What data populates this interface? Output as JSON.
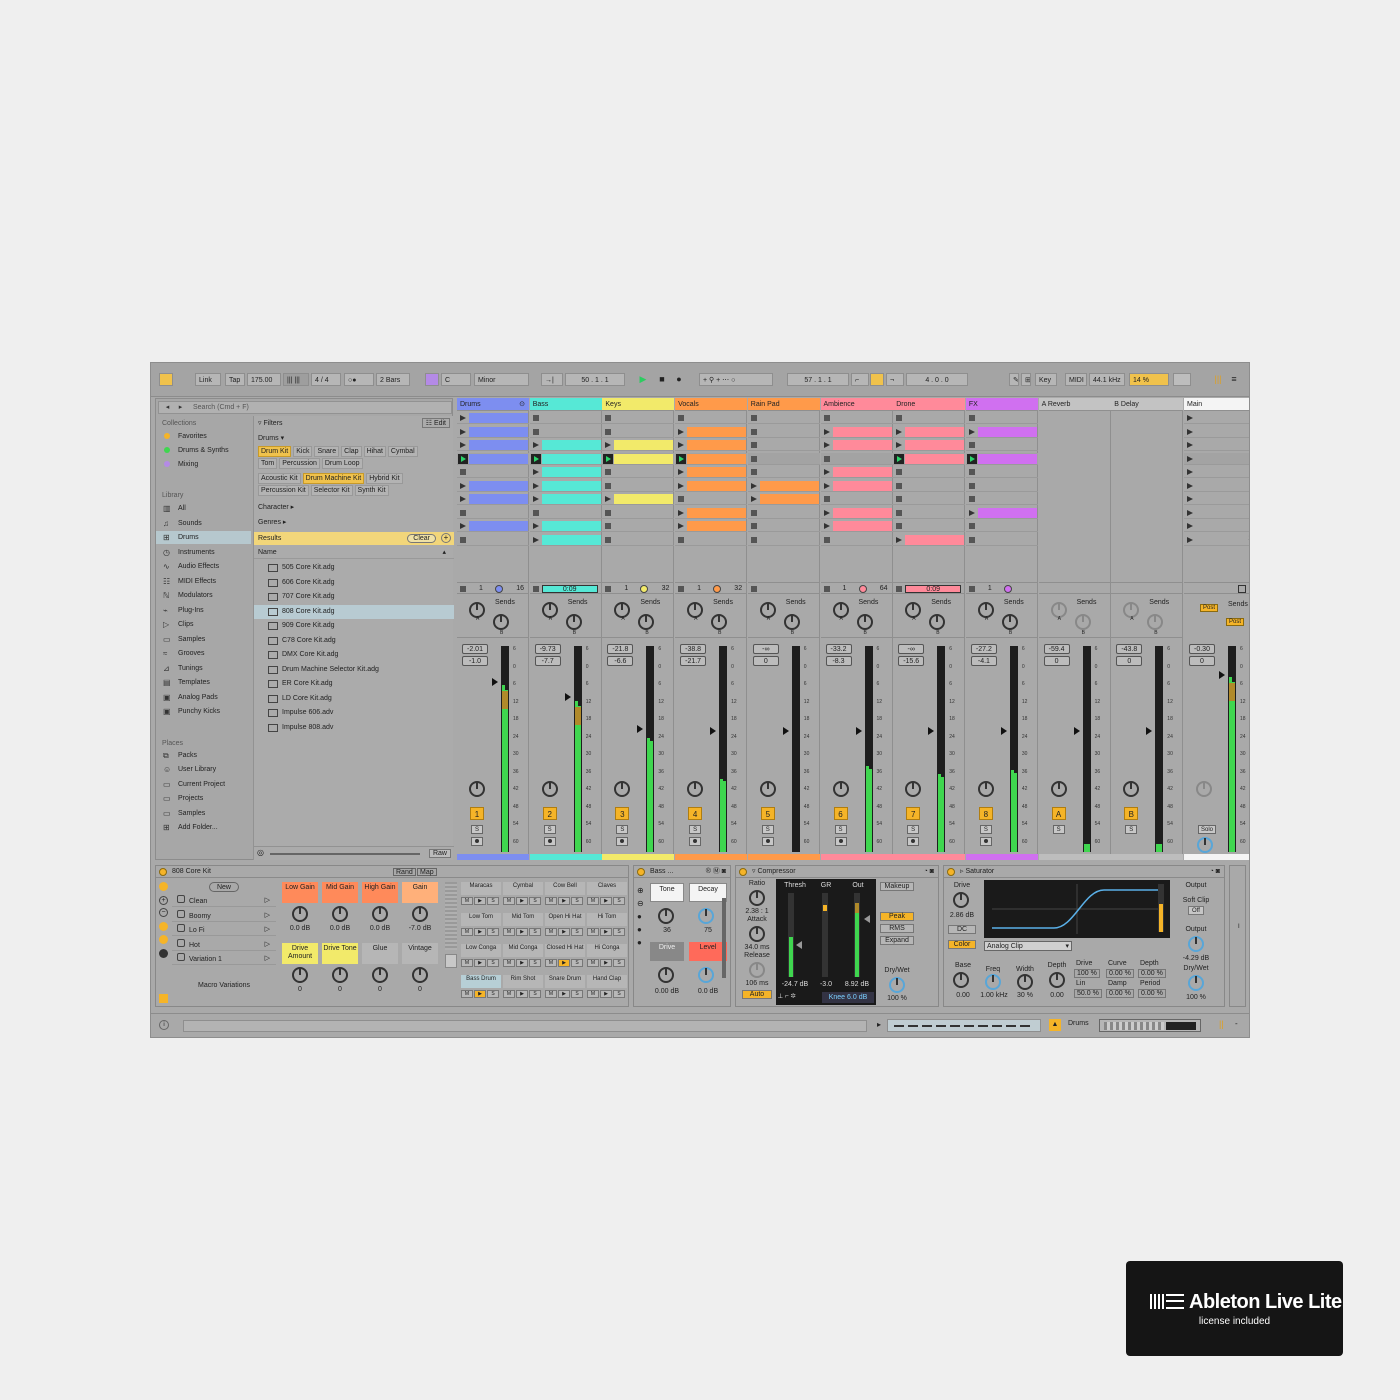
{
  "transport": {
    "link": "Link",
    "tap": "Tap",
    "tempo": "175.00",
    "signature": "4 / 4",
    "quantize": "2 Bars",
    "key": "C",
    "scale": "Minor",
    "arrangement_position": "50 .   1 .   1",
    "loop_start": "57 .   1 .   1",
    "loop_length": "4 .   0 .   0",
    "key_map": "Key",
    "midi_map": "MIDI",
    "sample_rate": "44.1 kHz",
    "cpu": "14 %"
  },
  "browser": {
    "search_placeholder": "Search (Cmd + F)",
    "collections_title": "Collections",
    "collections": [
      {
        "label": "Favorites",
        "color": "#f5b428"
      },
      {
        "label": "Drums & Synths",
        "color": "#3fd64f"
      },
      {
        "label": "Mixing",
        "color": "#b48ae6"
      }
    ],
    "library_title": "Library",
    "library": [
      {
        "label": "All",
        "icon": "bars-icon"
      },
      {
        "label": "Sounds",
        "icon": "note-icon"
      },
      {
        "label": "Drums",
        "icon": "grid-icon"
      },
      {
        "label": "Instruments",
        "icon": "clock-icon"
      },
      {
        "label": "Audio Effects",
        "icon": "wave-icon"
      },
      {
        "label": "MIDI Effects",
        "icon": "midi-icon"
      },
      {
        "label": "Modulators",
        "icon": "mod-icon"
      },
      {
        "label": "Plug-Ins",
        "icon": "plug-icon"
      },
      {
        "label": "Clips",
        "icon": "clip-icon"
      },
      {
        "label": "Samples",
        "icon": "sample-icon"
      },
      {
        "label": "Grooves",
        "icon": "groove-icon"
      },
      {
        "label": "Tunings",
        "icon": "tuning-icon"
      },
      {
        "label": "Templates",
        "icon": "template-icon"
      },
      {
        "label": "Analog Pads",
        "icon": "folder-icon"
      },
      {
        "label": "Punchy Kicks",
        "icon": "folder-icon"
      }
    ],
    "places_title": "Places",
    "places": [
      {
        "label": "Packs"
      },
      {
        "label": "User Library"
      },
      {
        "label": "Current Project"
      },
      {
        "label": "Projects"
      },
      {
        "label": "Samples"
      },
      {
        "label": "Add Folder..."
      }
    ],
    "filters_label": "Filters",
    "edit_label": "Edit",
    "drums_label": "Drums",
    "tags_row1": [
      "Drum Kit",
      "Kick",
      "Snare",
      "Clap",
      "Hihat",
      "Cymbal"
    ],
    "tags_row2": [
      "Tom",
      "Percussion",
      "Drum Loop"
    ],
    "tags_row3": [
      "Acoustic Kit",
      "Drum Machine Kit",
      "Hybrid Kit"
    ],
    "tags_row4": [
      "Percussion Kit",
      "Selector Kit",
      "Synth Kit"
    ],
    "character_label": "Character",
    "genres_label": "Genres",
    "results_label": "Results",
    "clear_label": "Clear",
    "name_header": "Name",
    "results": [
      "505 Core Kit.adg",
      "606 Core Kit.adg",
      "707 Core Kit.adg",
      "808 Core Kit.adg",
      "909 Core Kit.adg",
      "C78 Core Kit.adg",
      "DMX Core Kit.adg",
      "Drum Machine Selector Kit.adg",
      "ER Core Kit.adg",
      "LD Core Kit.adg",
      "Impulse 606.adv",
      "Impulse 808.adv"
    ],
    "raw_label": "Raw"
  },
  "tracks": [
    {
      "name": "Drums",
      "color": "#7d8ef0",
      "stop_a": "1",
      "stop_b": "16",
      "vol": "-2.01",
      "vol2": "-1.0",
      "num": "1",
      "meter": 0.82
    },
    {
      "name": "Bass",
      "color": "#56e8d6",
      "progress": "0:09",
      "vol": "-9.73",
      "vol2": "-7.7",
      "num": "2",
      "meter": 0.74
    },
    {
      "name": "Keys",
      "color": "#f2ea6a",
      "stop_a": "1",
      "stop_b": "32",
      "vol": "-21.8",
      "vol2": "-6.6",
      "num": "3",
      "meter": 0.56
    },
    {
      "name": "Vocals",
      "color": "#ff9a4a",
      "stop_a": "1",
      "stop_b": "32",
      "vol": "-38.8",
      "vol2": "-21.7",
      "num": "4",
      "meter": 0.36
    },
    {
      "name": "Rain Pad",
      "color": "#ff9a4a",
      "vol": "-∞",
      "vol2": "0",
      "num": "5",
      "meter": 0.0
    },
    {
      "name": "Ambience",
      "color": "#ff8a9a",
      "stop_a": "1",
      "stop_b": "64",
      "vol": "-33.2",
      "vol2": "-8.3",
      "num": "6",
      "meter": 0.42
    },
    {
      "name": "Drone",
      "color": "#ff8a9a",
      "progress": "0:09",
      "vol": "-∞",
      "vol2": "-15.6",
      "num": "7",
      "meter": 0.38
    },
    {
      "name": "FX",
      "color": "#d070f0",
      "stop_a": "1",
      "vol": "-27.2",
      "vol2": "-4.1",
      "num": "8",
      "meter": 0.4
    }
  ],
  "returns": [
    {
      "name": "A Reverb",
      "vol": "-59.4",
      "vol2": "0",
      "num": "A"
    },
    {
      "name": "B Delay",
      "vol": "-43.8",
      "vol2": "0",
      "num": "B"
    }
  ],
  "main": {
    "name": "Main",
    "scenes": [
      "1",
      "2",
      "3",
      "4",
      "5",
      "6",
      "7",
      "8",
      "9",
      "10"
    ],
    "vol": "-0.30",
    "vol2": "0",
    "solo": "Solo",
    "post": "Post"
  },
  "sends_label": "Sends",
  "meter_scale": [
    "6",
    "0",
    "6",
    "12",
    "18",
    "24",
    "30",
    "36",
    "42",
    "48",
    "54",
    "60"
  ],
  "devices": {
    "rack_name": "808 Core Kit",
    "rand": "Rand",
    "map": "Map",
    "new_label": "New",
    "variations": [
      "Clean",
      "Boomy",
      "Lo Fi",
      "Hot",
      "Variation 1"
    ],
    "macro_variations": "Macro Variations",
    "macros_row1": [
      {
        "label": "Low Gain",
        "value": "0.0 dB",
        "color": "#ff8a5a"
      },
      {
        "label": "Mid Gain",
        "value": "0.0 dB",
        "color": "#ff8a5a"
      },
      {
        "label": "High Gain",
        "value": "0.0 dB",
        "color": "#ff8a5a"
      },
      {
        "label": "Gain",
        "value": "-7.0 dB",
        "color": "#ffb07a"
      }
    ],
    "macros_row2": [
      {
        "label": "Drive Amount",
        "value": "0",
        "color": "#f2ea6a"
      },
      {
        "label": "Drive Tone",
        "value": "0",
        "color": "#f2ea6a"
      },
      {
        "label": "Glue",
        "value": "0",
        "color": "#b6b6b6"
      },
      {
        "label": "Vintage",
        "value": "0",
        "color": "#b6b6b6"
      }
    ],
    "pads": [
      [
        "Maracas",
        "Cymbal",
        "Cow Bell",
        "Claves"
      ],
      [
        "Low Tom",
        "Mid Tom",
        "Open Hi Hat",
        "Hi Tom"
      ],
      [
        "Low Conga",
        "Mid Conga",
        "Closed Hi Hat",
        "Hi Conga"
      ],
      [
        "Bass Drum",
        "Rim Shot",
        "Snare Drum",
        "Hand Clap"
      ]
    ],
    "bass_name": "Bass ...",
    "bass_tone": "Tone",
    "bass_decay": "Decay",
    "bass_tone_val": "36",
    "bass_decay_val": "75",
    "bass_drive": "Drive",
    "bass_level": "Level",
    "bass_drive_val": "0.00 dB",
    "bass_level_val": "0.0 dB",
    "comp_name": "Compressor",
    "comp": {
      "ratio": "Ratio",
      "ratio_val": "2.38 : 1",
      "attack": "Attack",
      "attack_val": "34.0 ms",
      "release": "Release",
      "release_val": "106 ms",
      "auto": "Auto",
      "thresh": "Thresh",
      "gr": "GR",
      "out": "Out",
      "thresh_val": "-24.7 dB",
      "gr_val": "-3.0",
      "out_val": "8.92 dB",
      "knee": "Knee",
      "knee_val": "6.0 dB",
      "makeup": "Makeup",
      "peak": "Peak",
      "rms": "RMS",
      "expand": "Expand",
      "drywet": "Dry/Wet",
      "drywet_val": "100 %"
    },
    "sat_name": "Saturator",
    "sat": {
      "drive": "Drive",
      "drive_val": "2.86 dB",
      "dc": "DC",
      "color": "Color",
      "mode": "Analog Clip",
      "base": "Base",
      "base_val": "0.00",
      "freq": "Freq",
      "freq_val": "1.00 kHz",
      "width": "Width",
      "width_val": "30 %",
      "depth": "Depth",
      "depth_val": "0.00",
      "drive2": "Drive",
      "drive2_val": "100 %",
      "lin": "Lin",
      "lin_val": "50.0 %",
      "curve": "Curve",
      "curve_val": "0.00 %",
      "damp": "Damp",
      "damp_val": "0.00 %",
      "depth2": "Depth",
      "depth2_val": "0.00 %",
      "period": "Period",
      "period_val": "0.00 %",
      "output": "Output",
      "softclip": "Soft Clip",
      "off": "Off",
      "output2": "Output",
      "output_val": "-4.29 dB",
      "drywet": "Dry/Wet",
      "drywet_val": "100 %"
    }
  },
  "status": {
    "track": "Drums"
  },
  "badge": {
    "name": "Ableton Live Lite",
    "sub": "license included"
  }
}
